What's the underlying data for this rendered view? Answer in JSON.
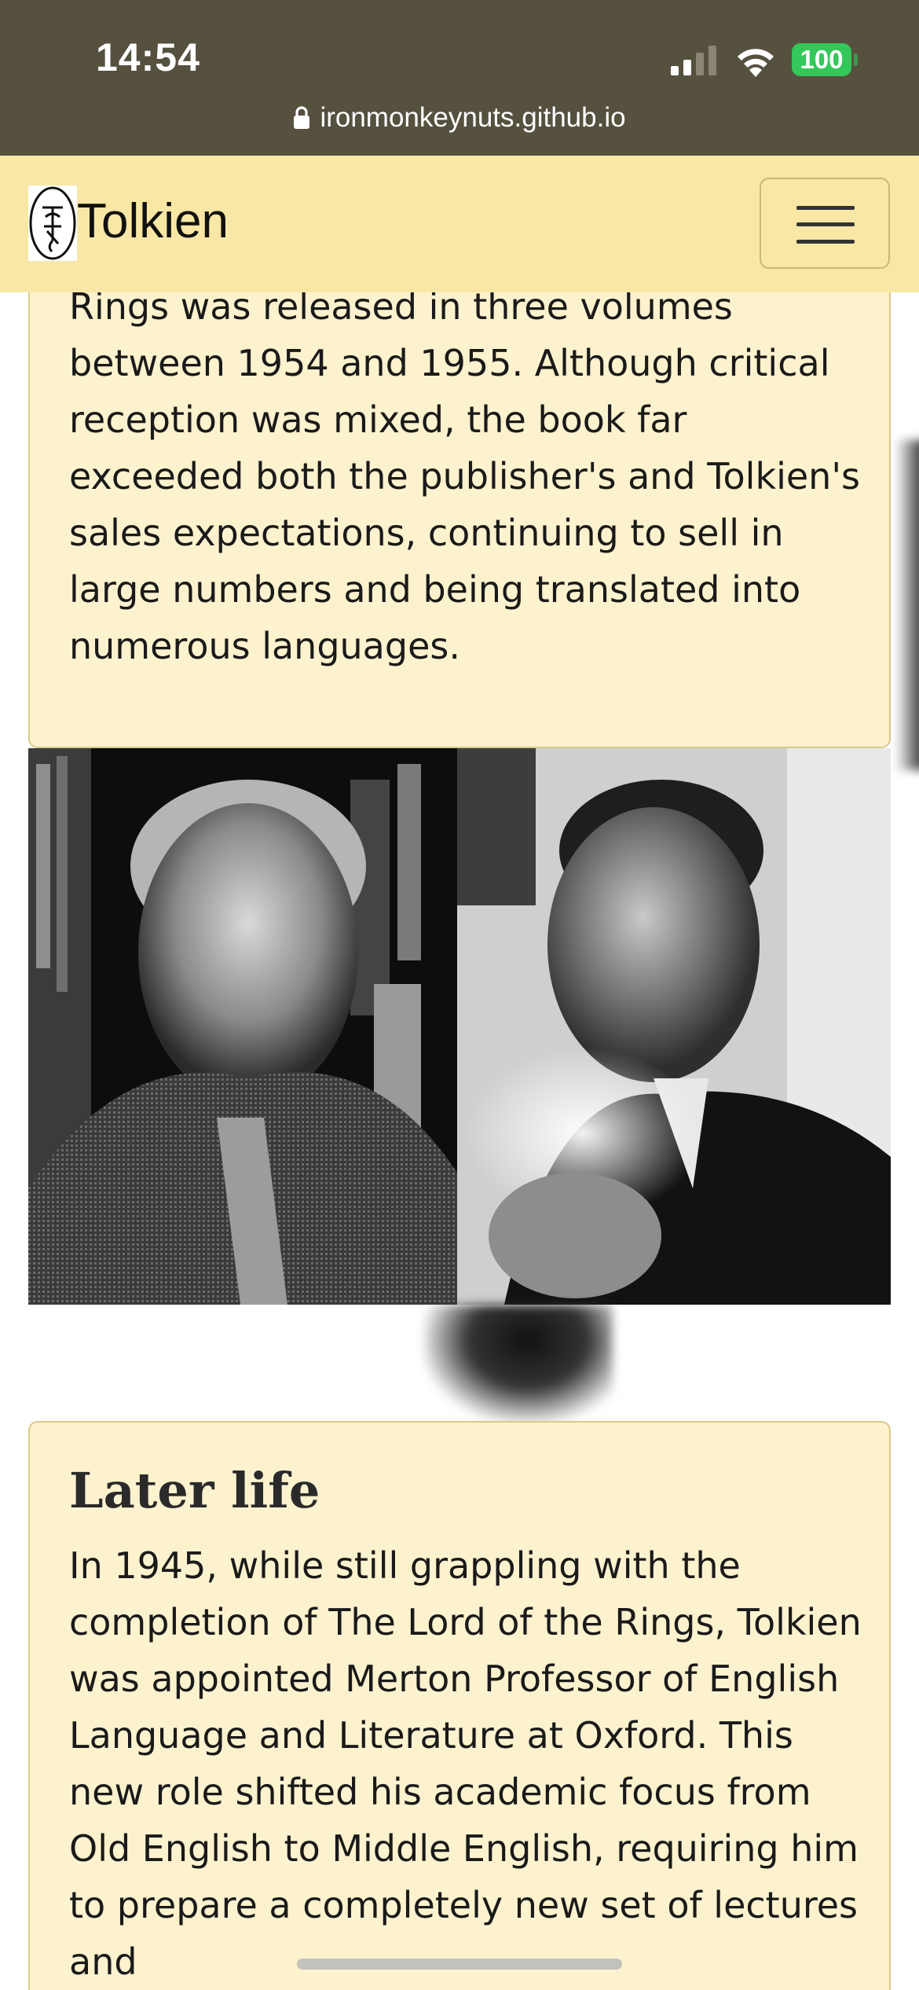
{
  "status_bar": {
    "time": "14:54",
    "battery": "100",
    "url": "ironmonkeynuts.github.io",
    "signal_icon": "cellular-signal-icon",
    "wifi_icon": "wifi-icon",
    "lock_icon": "lock-icon"
  },
  "navbar": {
    "brand": "Tolkien",
    "logo_icon": "tolkien-monogram-logo",
    "menu_icon": "hamburger-menu-icon"
  },
  "sections": {
    "publication": {
      "text": "Rings was released in three volumes between 1954 and 1955. Although critical reception was mixed, the book far exceeded both the publisher's and Tolkien's sales expectations, continuing to sell in large numbers and being translated into numerous languages."
    },
    "later_life": {
      "heading": "Later life",
      "text": "In 1945, while still grappling with the completion of The Lord of the Rings, Tolkien was appointed Merton Professor of English Language and Literature at Oxford. This new role shifted his academic focus from Old English to Middle English, requiring him to prepare a completely new set of lectures and"
    }
  },
  "colors": {
    "status_bar_bg": "#56503f",
    "navbar_bg": "#f9e7a5",
    "card_bg": "#fcf2ce",
    "card_border": "#d9c98a",
    "battery_green": "#34c759"
  }
}
